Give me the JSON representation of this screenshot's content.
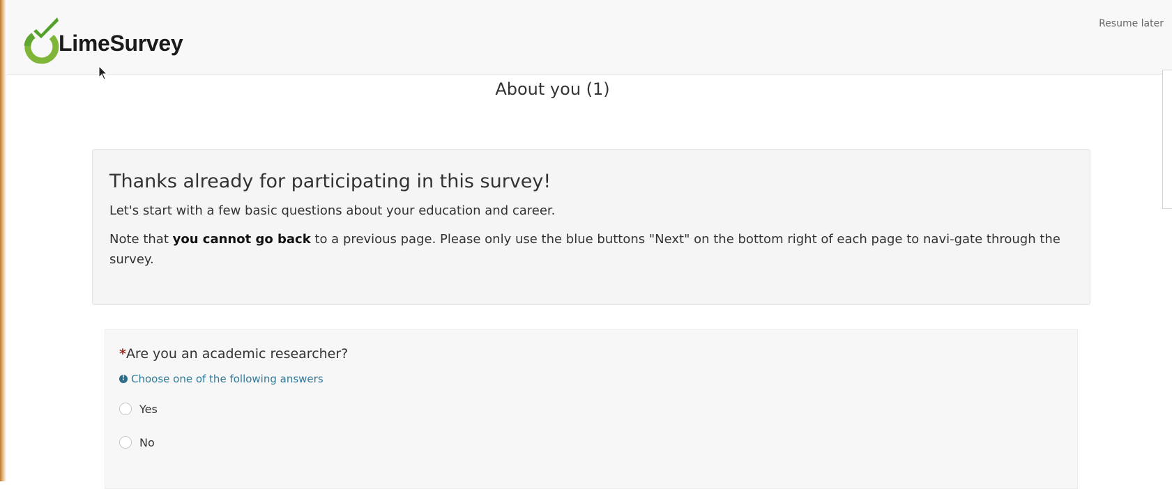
{
  "app": {
    "brand_name": "LimeSurvey",
    "brand_color": "#7fb638"
  },
  "header": {
    "resume_later": "Resume later"
  },
  "group": {
    "title": "About you (1)",
    "heading": "Thanks already for participating in this survey!",
    "intro": "Let's start with a few basic questions about your education and career.",
    "note_before": "Note that ",
    "note_bold": "you cannot go back",
    "note_after": " to a previous page. Please only use the blue buttons \"Next\" on the bottom right of each page to navi-gate through the survey."
  },
  "question": {
    "mandatory_mark": "*",
    "text": "Are you an academic researcher?",
    "help_icon": "info-circle-icon",
    "help_text": "Choose one of the following answers",
    "answers": [
      {
        "label": "Yes",
        "selected": false
      },
      {
        "label": "No",
        "selected": false
      }
    ]
  }
}
